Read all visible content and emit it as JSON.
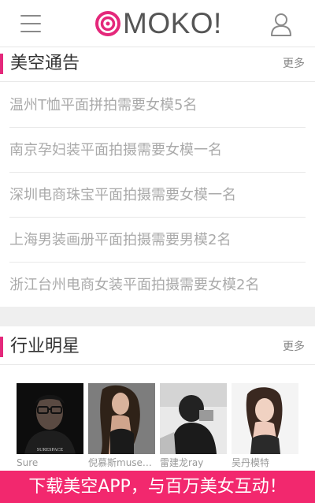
{
  "header": {
    "logo_text": "MOKO!",
    "brand_color": "#e4287b",
    "menu_icon": "hamburger-menu-icon",
    "user_icon": "user-icon"
  },
  "notices_section": {
    "title": "美空通告",
    "more_label": "更多",
    "items": [
      "温州T恤平面拼拍需要女模5名",
      "南京孕妇装平面拍摄需要女模一名",
      "深圳电商珠宝平面拍摄需要女模一名",
      "上海男装画册平面拍摄需要男模2名",
      "浙江台州电商女装平面拍摄需要女模2名"
    ]
  },
  "stars_section": {
    "title": "行业明星",
    "more_label": "更多",
    "items": [
      {
        "name": "Sure",
        "photo_caption": "SURESPACE"
      },
      {
        "name": "倪慕斯muse…"
      },
      {
        "name": "雷建龙ray"
      },
      {
        "name": "吴丹模特"
      }
    ]
  },
  "app_banner": {
    "text": "下载美空APP，与百万美女互动！",
    "color": "#f2286e"
  }
}
